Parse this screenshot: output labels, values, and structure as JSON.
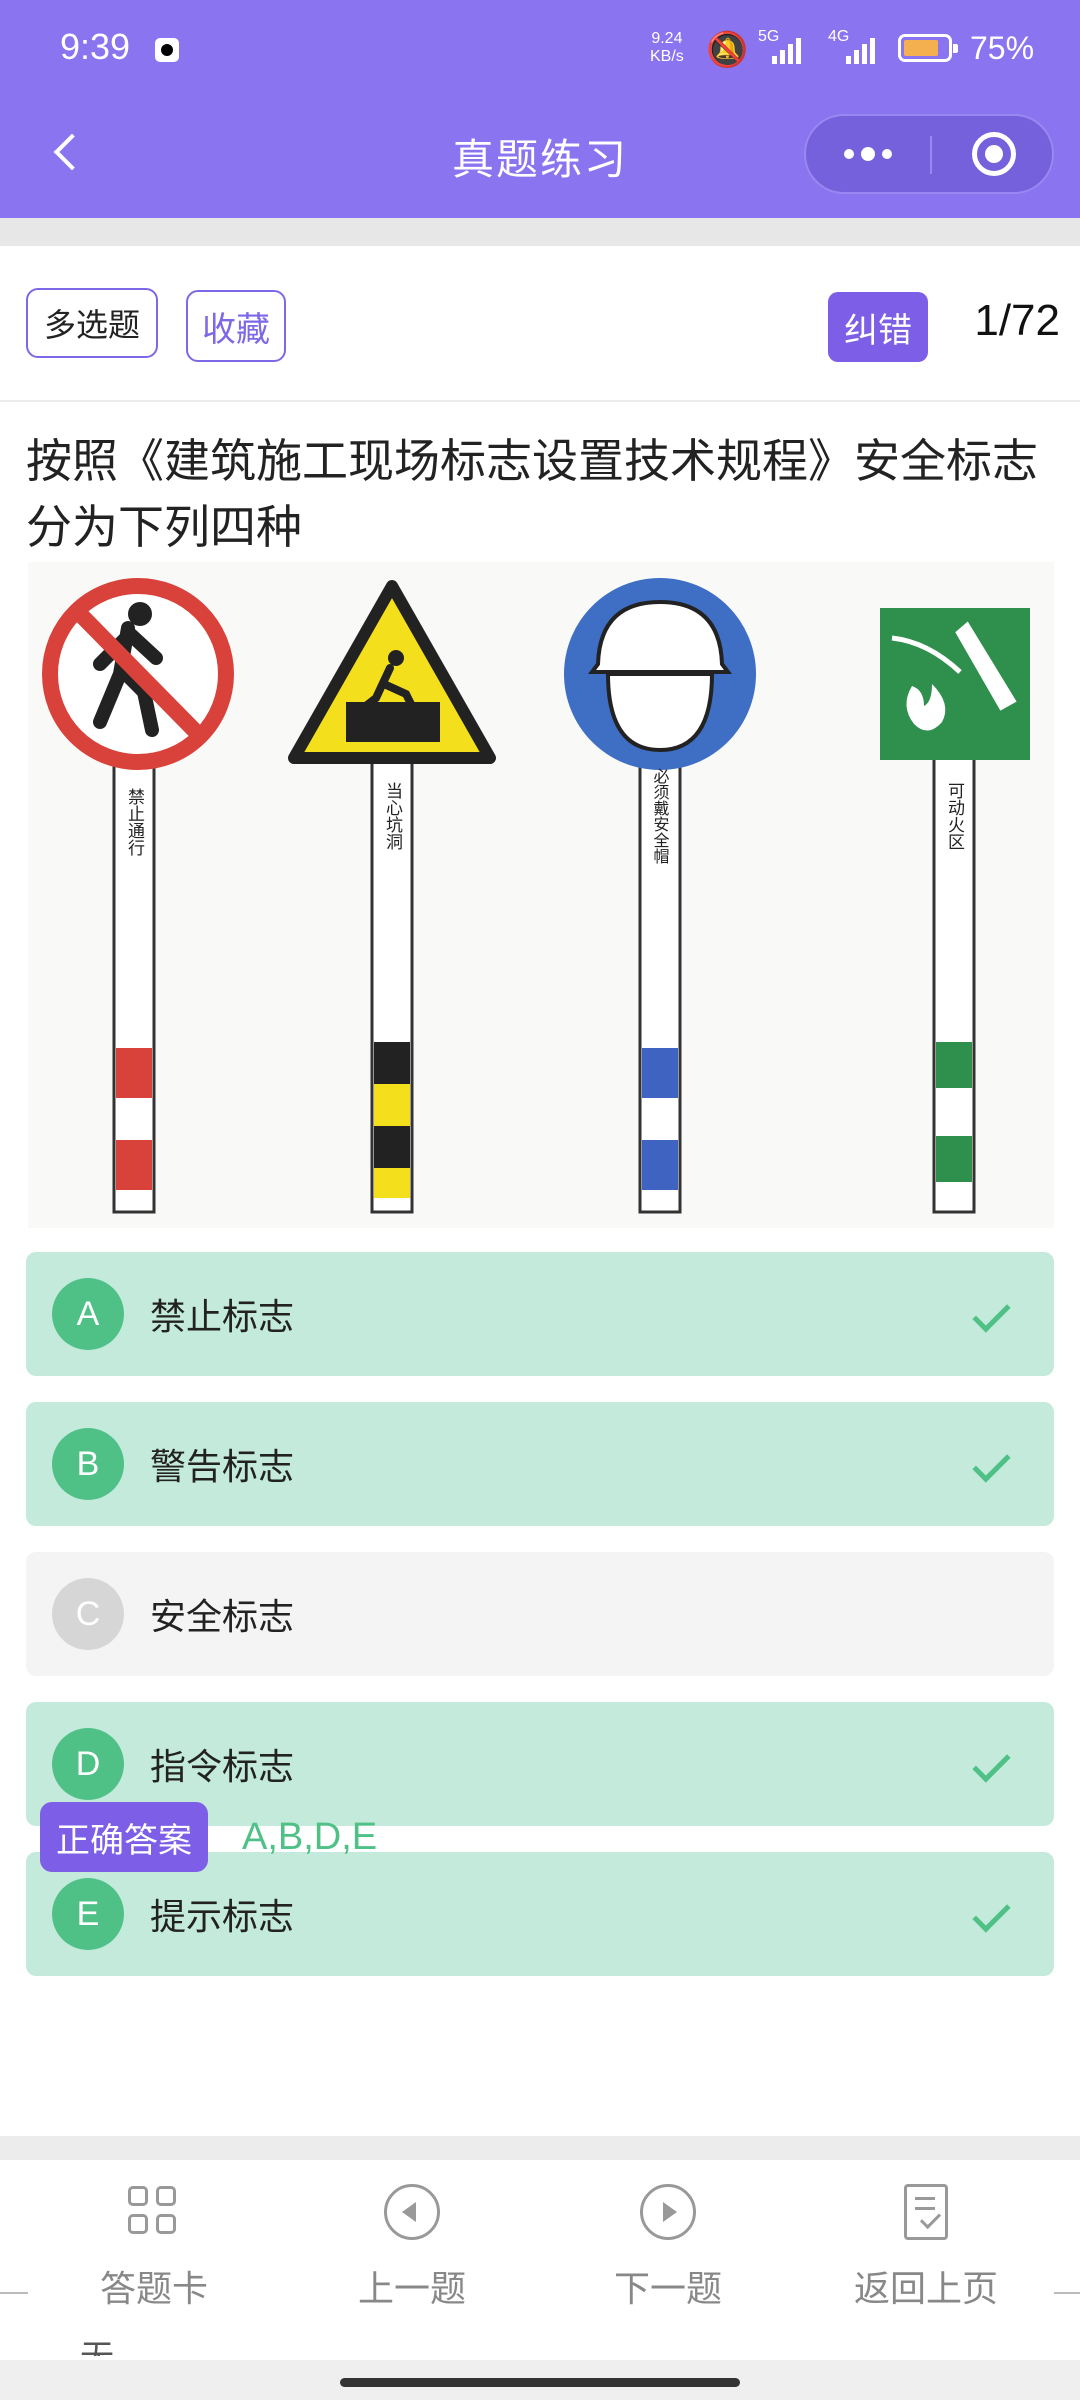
{
  "status_bar": {
    "time": "9:39",
    "net_speed_value": "9.24",
    "net_speed_unit": "KB/s",
    "network_1": "5G",
    "network_2": "4G",
    "battery": "75%"
  },
  "nav": {
    "title": "真题练习"
  },
  "question": {
    "type_tag": "多选题",
    "favorite_label": "收藏",
    "report_error_label": "纠错",
    "counter": "1/72",
    "text": "按照《建筑施工现场标志设置技术规程》安全标志分为下列四种",
    "figure_sign_texts": [
      "禁止通行",
      "当心坑洞",
      "必须戴安全帽",
      "可动火区"
    ]
  },
  "options": [
    {
      "letter": "A",
      "text": "禁止标志",
      "state": "correct"
    },
    {
      "letter": "B",
      "text": "警告标志",
      "state": "correct"
    },
    {
      "letter": "C",
      "text": "安全标志",
      "state": "neutral"
    },
    {
      "letter": "D",
      "text": "指令标志",
      "state": "correct"
    },
    {
      "letter": "E",
      "text": "提示标志",
      "state": "correct"
    }
  ],
  "answer": {
    "label": "正确答案",
    "value": "A,B,D,E"
  },
  "bottom_tabs": [
    {
      "label": "答题卡",
      "icon": "grid-icon"
    },
    {
      "label": "上一题",
      "icon": "prev-circle-icon"
    },
    {
      "label": "下一题",
      "icon": "next-circle-icon"
    },
    {
      "label": "返回上页",
      "icon": "document-check-icon"
    }
  ],
  "stray_text": "无",
  "colors": {
    "header": "#8a74ef",
    "accent": "#7d5ee6",
    "correct_bg": "#c3eadb",
    "correct_green": "#4fc187",
    "neutral_bg": "#f4f4f4"
  }
}
